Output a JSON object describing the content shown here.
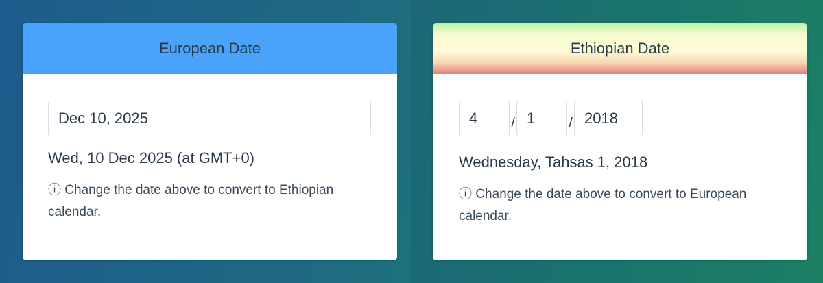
{
  "european": {
    "title": "European Date",
    "date_input_value": "Dec 10, 2025",
    "converted_text": "Wed, 10 Dec 2025 (at GMT+0)",
    "hint_icon": "ⓘ",
    "hint_text": "Change the date above to convert to Ethiopian calendar."
  },
  "ethiopian": {
    "title": "Ethiopian Date",
    "day_value": "4",
    "month_value": "1",
    "year_value": "2018",
    "separator": "/",
    "converted_text": "Wednesday, Tahsas 1, 2018",
    "hint_icon": "ⓘ",
    "hint_text": "Change the date above to convert to European calendar."
  },
  "colors": {
    "european_header": "#4aa3fb",
    "ethiopian_header_top": "#b6f5a4",
    "ethiopian_header_middle": "#fffbd8",
    "ethiopian_header_bottom": "#e87c7a"
  }
}
